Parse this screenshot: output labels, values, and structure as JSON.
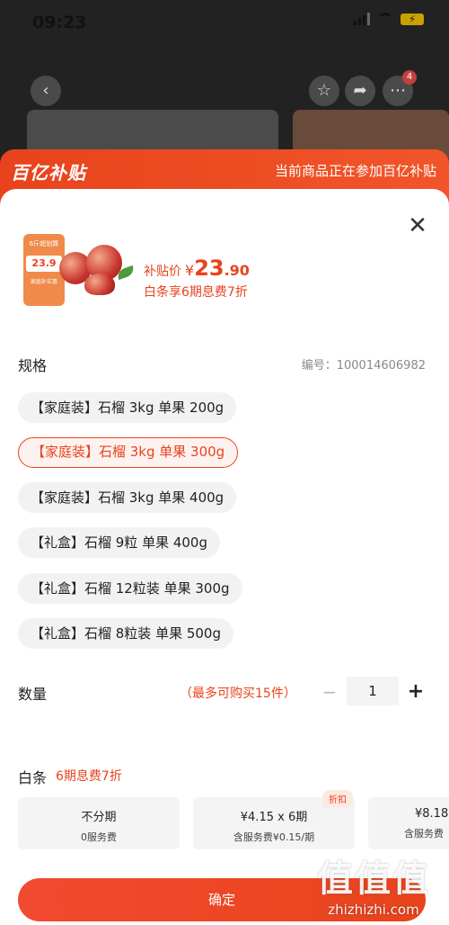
{
  "status_bar": {
    "time": "09:23",
    "battery": "⚡"
  },
  "top_nav": {
    "cart_badge": "4"
  },
  "banner": {
    "logo": "百亿补贴",
    "text": "当前商品正在参加百亿补贴"
  },
  "product": {
    "promo_tag_title": "6斤超划算",
    "promo_tag_price": "23.9",
    "promo_tag_note": "家庭补实惠",
    "price_label": "补贴价",
    "currency": "¥",
    "price_int": "23",
    "price_dec": ".90",
    "baitiao_offer": "白条享6期息费7折"
  },
  "spec": {
    "title": "规格",
    "sku_label": "编号：100014606982",
    "options": [
      {
        "label": "【家庭装】石榴 3kg 单果 200g",
        "selected": false
      },
      {
        "label": "【家庭装】石榴 3kg 单果 300g",
        "selected": true
      },
      {
        "label": "【家庭装】石榴 3kg 单果 400g",
        "selected": false
      },
      {
        "label": "【礼盒】石榴 9粒 单果 400g",
        "selected": false
      },
      {
        "label": "【礼盒】石榴 12粒装 单果 300g",
        "selected": false
      },
      {
        "label": "【礼盒】石榴 8粒装 单果 500g",
        "selected": false
      }
    ]
  },
  "quantity": {
    "title": "数量",
    "limit": "（最多可购买15件）",
    "minus": "−",
    "value": "1",
    "plus": "+"
  },
  "baitiao": {
    "title": "白条",
    "subtitle": "6期息费7折",
    "plans": [
      {
        "main": "不分期",
        "sub": "0服务费",
        "tag": ""
      },
      {
        "main": "¥4.15 x 6期",
        "sub": "含服务费¥0.15/期",
        "tag": "折扣"
      },
      {
        "main": "¥8.18",
        "sub": "含服务费",
        "tag": ""
      }
    ]
  },
  "confirm": {
    "label": "确定"
  },
  "watermark": {
    "logo": "值值值",
    "site": "zhizhizhi.com"
  },
  "colors": {
    "accent": "#e8431c",
    "selected_bg": "#fdf2f0",
    "chip_bg": "#f2f2f2"
  }
}
